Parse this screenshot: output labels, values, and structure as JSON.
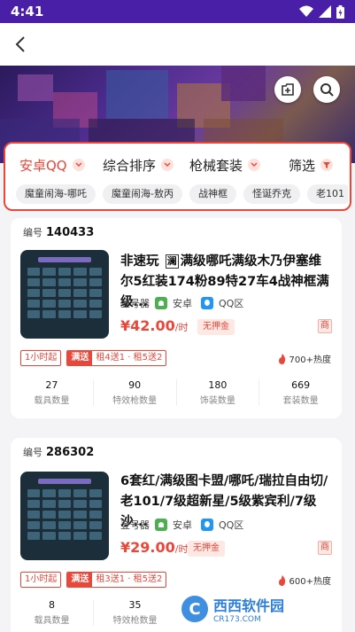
{
  "status_bar": {
    "time": "4:41"
  },
  "nav": {
    "back_icon": "chevron-left-icon"
  },
  "banner": {
    "buttons": [
      "add-shortcut-icon",
      "search-icon"
    ]
  },
  "filters": {
    "dropdowns": [
      {
        "label": "安卓QQ",
        "active": true
      },
      {
        "label": "综合排序",
        "active": false
      },
      {
        "label": "枪械套装",
        "active": false
      },
      {
        "label": "筛选",
        "active": false
      }
    ],
    "tags": [
      "魔童闹海-哪吒",
      "魔童闹海-敖丙",
      "战神框",
      "怪诞乔克",
      "老101"
    ]
  },
  "listings": [
    {
      "number_label": "编号",
      "number": "140433",
      "title": "非速玩 满级哪吒满级木乃伊塞维尔5红装174粉89特27车4战神框满级...",
      "title_tag": "澜",
      "login_label": "登号器",
      "platform": "安卓",
      "region": "QQ区",
      "price": "¥42.00",
      "price_unit": "/时",
      "deposit": "无押金",
      "merchant": "商",
      "rent_start": "1小时起",
      "promo_label": "满送",
      "promo_text": "租4送1 · 租5送2",
      "heat": "700+热度",
      "stats": [
        {
          "value": "27",
          "label": "载具数量"
        },
        {
          "value": "90",
          "label": "特效枪数量"
        },
        {
          "value": "180",
          "label": "饰装数量"
        },
        {
          "value": "669",
          "label": "套装数量"
        }
      ]
    },
    {
      "number_label": "编号",
      "number": "286302",
      "title": "6套红/满级图卡盟/哪吒/瑞拉自由切/老101/7级超新星/5级紫宾利/7级沙...",
      "title_tag": "",
      "login_label": "登号器",
      "platform": "安卓",
      "region": "QQ区",
      "price": "¥29.00",
      "price_unit": "/时",
      "deposit": "无押金",
      "merchant": "商",
      "rent_start": "1小时起",
      "promo_label": "满送",
      "promo_text": "租3送1 · 租5送2",
      "heat": "600+热度",
      "stats": [
        {
          "value": "8",
          "label": "载具数量"
        },
        {
          "value": "35",
          "label": "特效枪数量"
        }
      ]
    }
  ],
  "watermark": {
    "logo": "C",
    "text": "西西软件园",
    "sub": "CR173.COM"
  },
  "colors": {
    "accent": "#e8473a",
    "status_bar": "#4a1fa8"
  }
}
